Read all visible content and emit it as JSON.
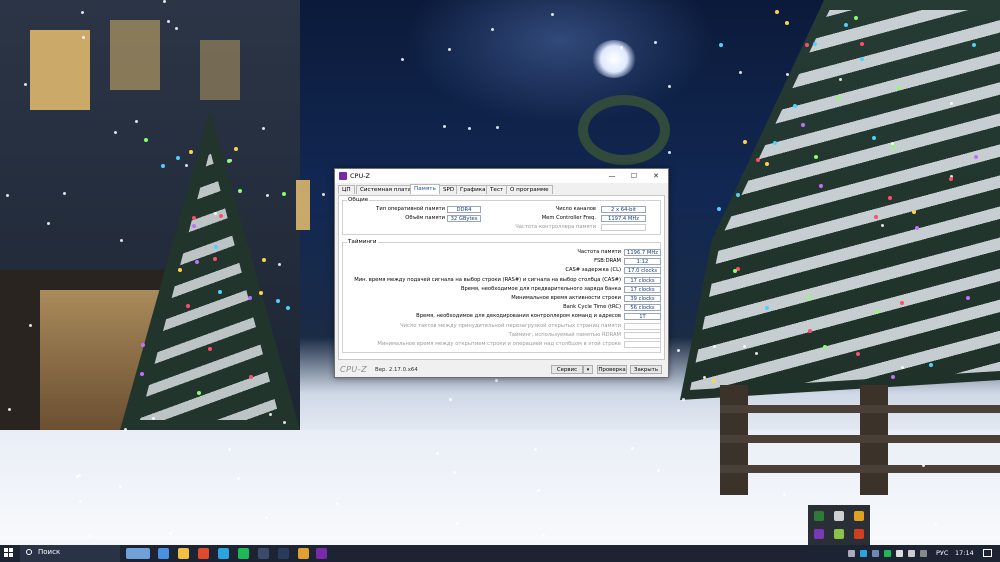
{
  "window": {
    "title": "CPU-Z",
    "controls": {
      "minimize": "—",
      "maximize": "☐",
      "close": "✕"
    }
  },
  "tabs": [
    {
      "label": "ЦП"
    },
    {
      "label": "Системная плата"
    },
    {
      "label": "Память",
      "active": true
    },
    {
      "label": "SPD"
    },
    {
      "label": "Графика"
    },
    {
      "label": "Тест"
    },
    {
      "label": "О программе"
    }
  ],
  "general": {
    "title": "Общие",
    "type_label": "Тип оперативной памяти",
    "type_value": "DDR4",
    "size_label": "Объём памяти",
    "size_value": "32 GBytes",
    "channels_label": "Число каналов",
    "channels_value": "2 x 64-bit",
    "mc_freq_label": "Mem Controller Freq.",
    "mc_freq_value": "1197.4 MHz",
    "nb_freq_label": "Частота контроллера памяти",
    "nb_freq_value": ""
  },
  "timings": {
    "title": "Тайминги",
    "rows": [
      {
        "label": "Частота памяти",
        "value": "1196.7 MHz",
        "enabled": true
      },
      {
        "label": "FSB:DRAM",
        "value": "1:12",
        "enabled": true
      },
      {
        "label": "CAS# задержка (CL)",
        "value": "17.0 clocks",
        "enabled": true
      },
      {
        "label": "Мин. время между подачей сигнала на выбор строки (RAS#) и сигнала на выбор столбца (CAS#)",
        "value": "17 clocks",
        "enabled": true
      },
      {
        "label": "Время, необходимое для предварительного заряда банка",
        "value": "17 clocks",
        "enabled": true
      },
      {
        "label": "Минимальное время активности строки",
        "value": "39 clocks",
        "enabled": true
      },
      {
        "label": "Bank Cycle Time (tRC)",
        "value": "56 clocks",
        "enabled": true
      },
      {
        "label": "Время, необходимое для декодирования контроллером команд и адресов",
        "value": "1T",
        "enabled": true
      },
      {
        "label": "Число тактов между принудительной перезагрузкой открытых страниц памяти",
        "value": "",
        "enabled": false
      },
      {
        "label": "Тайминг, используемый памятью RDRAM",
        "value": "",
        "enabled": false
      },
      {
        "label": "Минимальное время между открытием строки и операцией над столбцом в этой строке",
        "value": "",
        "enabled": false
      }
    ]
  },
  "footer": {
    "logo": "CPU-Z",
    "version": "Вер. 2.17.0.x64",
    "service_button": "Сервис",
    "service_dropdown": "▾",
    "validate_button": "Проверка",
    "close_button": "Закрыть"
  },
  "taskbar": {
    "search_label": "Поиск",
    "language": "РУС",
    "time": "17:14"
  },
  "colors": {
    "accent_tab": "#1f4fb4",
    "value_text": "#1a3d8f",
    "taskbar": "#1c2434"
  }
}
